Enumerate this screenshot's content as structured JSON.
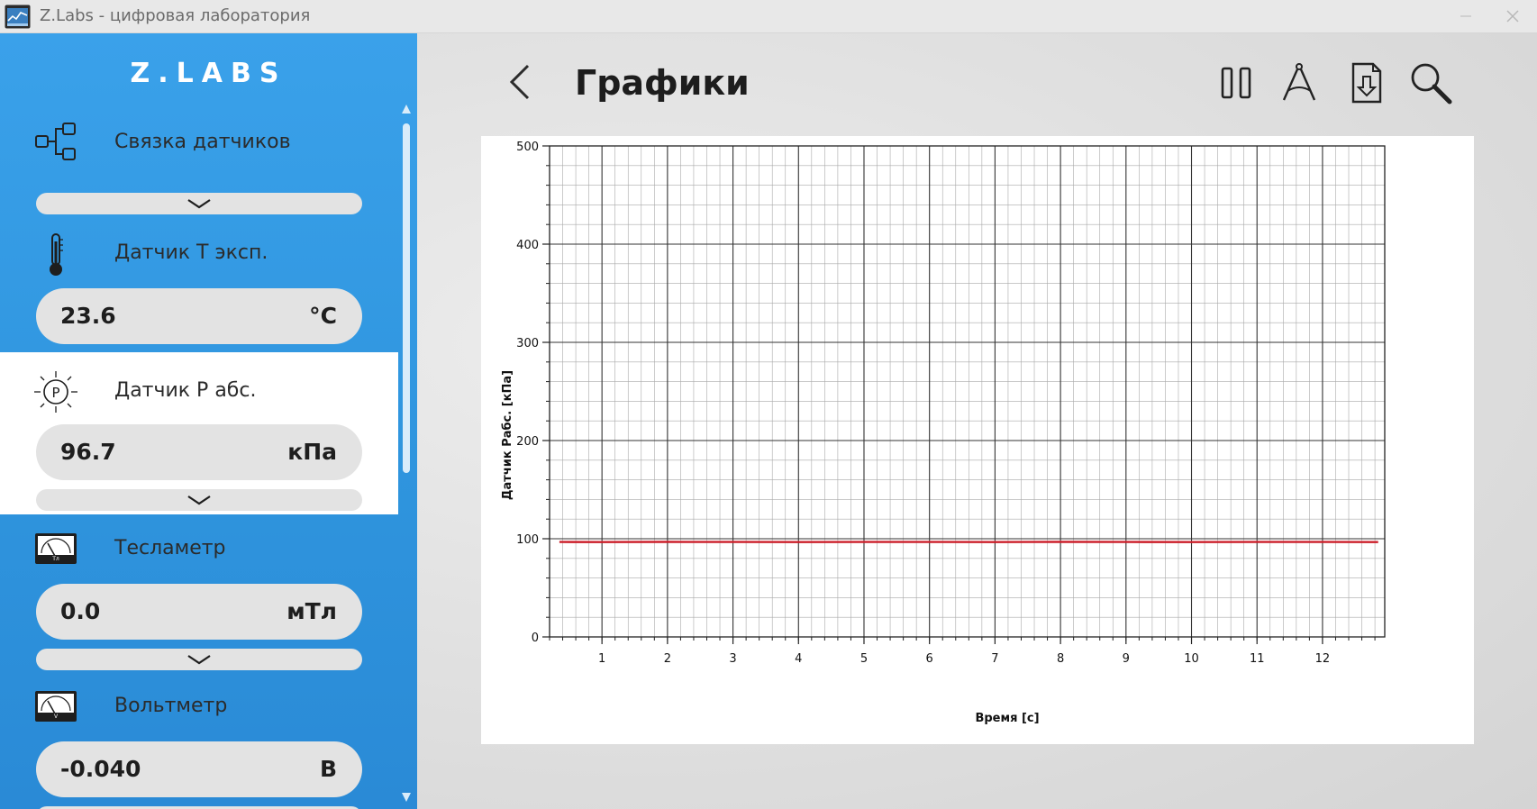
{
  "window": {
    "title": "Z.Labs - цифровая лаборатория",
    "app_icon": "chart-window-icon",
    "minimize_icon": "minimize-icon",
    "close_icon": "close-icon"
  },
  "sidebar": {
    "logo": "Z.LABS",
    "sensor_link": {
      "label": "Связка датчиков",
      "icon": "sensor-link-icon"
    },
    "panels": [
      {
        "label": "Датчик Т эксп.",
        "value": "23.6",
        "unit": "°C",
        "icon": "thermometer-icon",
        "selected": false
      },
      {
        "label": "Датчик Р абс.",
        "value": "96.7",
        "unit": "кПа",
        "icon": "pressure-sensor-icon",
        "selected": true
      },
      {
        "label": "Тесламетр",
        "value": "0.0",
        "unit": "мТл",
        "icon": "teslameter-icon",
        "selected": false
      },
      {
        "label": "Вольтметр",
        "value": "-0.040",
        "unit": "В",
        "icon": "voltmeter-icon",
        "selected": false
      }
    ]
  },
  "main": {
    "title": "Графики",
    "back_icon": "back-arrow-icon",
    "toolbar": [
      "pause-icon",
      "compass-icon",
      "export-file-icon",
      "zoom-icon"
    ]
  },
  "chart_data": {
    "type": "line",
    "xlabel": "Время [с]",
    "ylabel": "Датчик Рабс. [кПа]",
    "xlim": [
      0.2,
      12.95
    ],
    "ylim": [
      0,
      500
    ],
    "x_ticks": [
      1,
      2,
      3,
      4,
      5,
      6,
      7,
      8,
      9,
      10,
      11,
      12
    ],
    "y_ticks": [
      0,
      100,
      200,
      300,
      400,
      500
    ],
    "grid": true,
    "series": [
      {
        "color": "#cc1f2a",
        "x": [
          0.35,
          1,
          2,
          3,
          4,
          5,
          6,
          7,
          8,
          9,
          10,
          11,
          12,
          12.85
        ],
        "y": [
          96.7,
          96.6,
          96.8,
          96.7,
          96.6,
          96.7,
          96.7,
          96.6,
          96.8,
          96.7,
          96.6,
          96.7,
          96.7,
          96.6
        ]
      }
    ]
  }
}
